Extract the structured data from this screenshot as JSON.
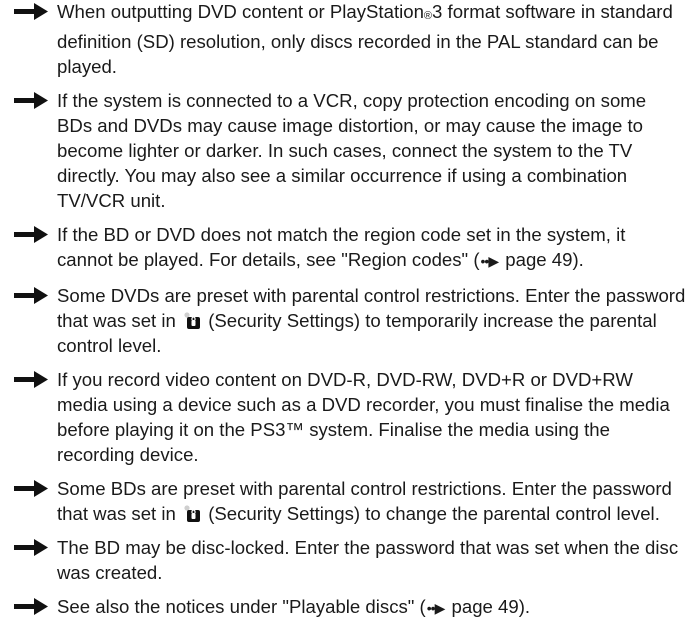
{
  "notes": [
    {
      "segments": [
        "When outputting DVD content or PlayStation",
        "®",
        "3 format software in standard definition (SD) resolution, only discs recorded in the PAL standard can be played."
      ]
    },
    {
      "text": "If the system is connected to a VCR, copy protection encoding on some BDs and DVDs may cause image distortion, or may cause the image to become lighter or darker. In such cases, connect the system to the TV directly. You may also see a similar occurrence if using a combination TV/VCR unit."
    },
    {
      "before": "If the BD or DVD does not match the region code set in the system, it cannot be played. For details, see \"Region codes\" (",
      "page_ref_icon": "page-reference-arrow",
      "after": " page 49)."
    },
    {
      "before": "Some DVDs are preset with parental control restrictions. Enter the password that was set in ",
      "lock_icon": "security-settings-lock",
      "after": " (Security Settings) to temporarily increase the parental control level."
    },
    {
      "text": "If you record video content on DVD-R, DVD-RW, DVD+R or DVD+RW media using a device such as a DVD recorder, you must finalise the media before playing it on the PS3™ system. Finalise the media using the recording device."
    },
    {
      "before": "Some BDs are preset with parental control restrictions. Enter the password that was set in ",
      "lock_icon": "security-settings-lock",
      "after": " (Security Settings) to change the parental control level."
    },
    {
      "text": "The BD may be disc-locked. Enter the password that was set when the disc was created."
    },
    {
      "before": "See also the notices under \"Playable discs\" (",
      "page_ref_icon": "page-reference-arrow",
      "after": " page 49)."
    }
  ],
  "icons": {
    "bullet": "right-arrow-icon",
    "page_ref_glyph": "••▶",
    "lock": "lock-icon"
  },
  "colors": {
    "text": "#1a1a1a",
    "arrow": "#111111"
  }
}
